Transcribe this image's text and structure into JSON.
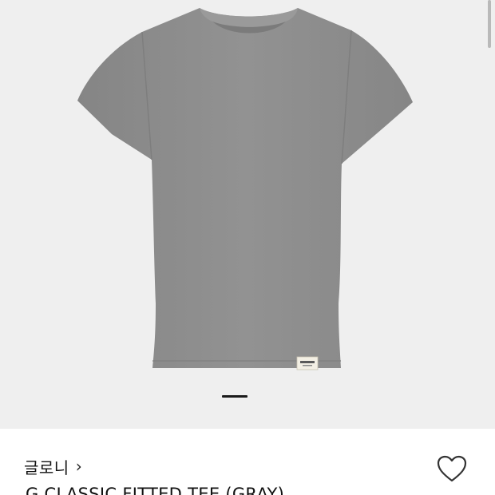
{
  "gallery": {
    "background": "#efefef",
    "product_color": "#8c8c8c",
    "label_text": "GLOWNY",
    "active_slide": 1
  },
  "product": {
    "brand": "글로니",
    "brand_chevron": "›",
    "title": "G CLASSIC FITTED TEE (GRAY)",
    "wishlist_icon": "heart-outline"
  }
}
